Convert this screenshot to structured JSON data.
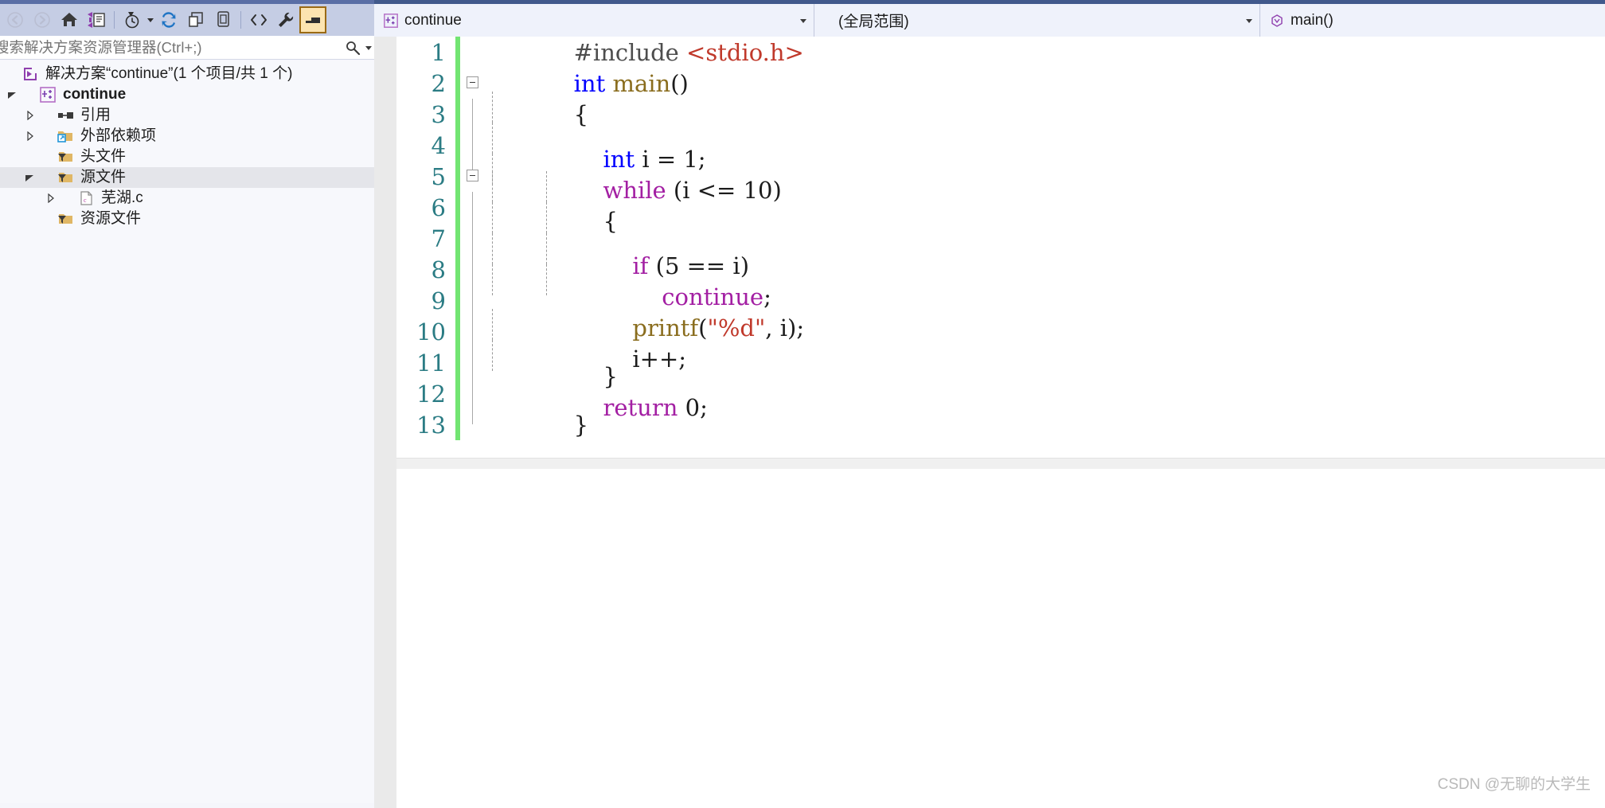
{
  "solution_explorer": {
    "toolbar": {
      "buttons": [
        {
          "name": "back-icon",
          "label": "后退"
        },
        {
          "name": "forward-icon",
          "label": "前进"
        },
        {
          "name": "home-icon",
          "label": "主页"
        },
        {
          "name": "sync-with-active-document-icon",
          "label": "与活动文档同步"
        },
        {
          "name": "pending-changes-filter-icon",
          "label": "挂起的更改筛选器"
        },
        {
          "name": "refresh-icon",
          "label": "刷新"
        },
        {
          "name": "collapse-all-icon",
          "label": "全部折叠"
        },
        {
          "name": "show-all-files-icon",
          "label": "显示所有文件"
        },
        {
          "name": "view-code-icon",
          "label": "查看代码"
        },
        {
          "name": "properties-icon",
          "label": "属性"
        },
        {
          "name": "preview-selected-items-icon",
          "label": "预览选定项"
        }
      ]
    },
    "search": {
      "placeholder": "搜索解决方案资源管理器(Ctrl+;)",
      "value": "",
      "icon": "search-icon",
      "dropdown_icon": "chevron-down-icon"
    },
    "tree": [
      {
        "label": "解决方案“continue”(1 个项目/共 1 个)",
        "icon": "solution-icon",
        "indent": 0,
        "twisty": "none",
        "bold": false,
        "selected": false
      },
      {
        "label": "continue",
        "icon": "cpp-project-icon",
        "indent": 1,
        "twisty": "expanded",
        "bold": true,
        "selected": false
      },
      {
        "label": "引用",
        "icon": "references-icon",
        "indent": 2,
        "twisty": "collapsed",
        "bold": false,
        "selected": false
      },
      {
        "label": "外部依赖项",
        "icon": "external-dependencies-icon",
        "indent": 2,
        "twisty": "collapsed",
        "bold": false,
        "selected": false
      },
      {
        "label": "头文件",
        "icon": "filter-folder-icon",
        "indent": 2,
        "twisty": "none",
        "bold": false,
        "selected": false
      },
      {
        "label": "源文件",
        "icon": "filter-folder-icon",
        "indent": 2,
        "twisty": "expanded",
        "bold": false,
        "selected": true
      },
      {
        "label": "芜湖.c",
        "icon": "c-file-icon",
        "indent": 3,
        "twisty": "collapsed",
        "bold": false,
        "selected": false
      },
      {
        "label": "资源文件",
        "icon": "filter-folder-icon",
        "indent": 2,
        "twisty": "none",
        "bold": false,
        "selected": false
      }
    ]
  },
  "navigation_bar": {
    "project_combo": {
      "value": "continue",
      "icon": "cpp-project-icon",
      "dropdown_icon": "chevron-down-icon"
    },
    "scope_combo": {
      "value": "(全局范围)",
      "dropdown_icon": "chevron-down-icon"
    },
    "member_combo": {
      "value": "main()",
      "icon": "method-icon",
      "dropdown_icon": "chevron-down-icon"
    }
  },
  "editor": {
    "lines": [
      {
        "number": "1",
        "fold": "none",
        "guides": 0,
        "tokens": [
          {
            "t": "#include ",
            "c": "pre"
          },
          {
            "t": "<stdio.h>",
            "c": "red"
          }
        ]
      },
      {
        "number": "2",
        "fold": "box",
        "guides": 0,
        "tokens": [
          {
            "t": "int",
            "c": "blue"
          },
          {
            "t": " ",
            "c": "plain"
          },
          {
            "t": "main",
            "c": "brown"
          },
          {
            "t": "()",
            "c": "plain"
          }
        ]
      },
      {
        "number": "3",
        "fold": "line",
        "guides": 0,
        "tokens": [
          {
            "t": "{",
            "c": "plain"
          }
        ]
      },
      {
        "number": "4",
        "fold": "line",
        "guides": 1,
        "tokens": [
          {
            "t": "    ",
            "c": "plain"
          },
          {
            "t": "int",
            "c": "blue"
          },
          {
            "t": " i = ",
            "c": "plain"
          },
          {
            "t": "1",
            "c": "plain"
          },
          {
            "t": ";",
            "c": "plain"
          }
        ]
      },
      {
        "number": "5",
        "fold": "box",
        "guides": 1,
        "tokens": [
          {
            "t": "    ",
            "c": "plain"
          },
          {
            "t": "while",
            "c": "purple"
          },
          {
            "t": " (i <= ",
            "c": "plain"
          },
          {
            "t": "10",
            "c": "plain"
          },
          {
            "t": ")",
            "c": "plain"
          }
        ]
      },
      {
        "number": "6",
        "fold": "line",
        "guides": 1,
        "tokens": [
          {
            "t": "    {",
            "c": "plain"
          }
        ]
      },
      {
        "number": "7",
        "fold": "line",
        "guides": 2,
        "tokens": [
          {
            "t": "        ",
            "c": "plain"
          },
          {
            "t": "if",
            "c": "purple"
          },
          {
            "t": " (",
            "c": "plain"
          },
          {
            "t": "5",
            "c": "plain"
          },
          {
            "t": " == i)",
            "c": "plain"
          }
        ]
      },
      {
        "number": "8",
        "fold": "line",
        "guides": 2,
        "tokens": [
          {
            "t": "            ",
            "c": "plain"
          },
          {
            "t": "continue",
            "c": "purple"
          },
          {
            "t": ";",
            "c": "plain"
          }
        ]
      },
      {
        "number": "9",
        "fold": "line",
        "guides": 2,
        "tokens": [
          {
            "t": "        ",
            "c": "plain"
          },
          {
            "t": "printf",
            "c": "brown"
          },
          {
            "t": "(",
            "c": "plain"
          },
          {
            "t": "\"%d\"",
            "c": "red"
          },
          {
            "t": ", i);",
            "c": "plain"
          }
        ]
      },
      {
        "number": "10",
        "fold": "line",
        "guides": 2,
        "tokens": [
          {
            "t": "        i++;",
            "c": "plain"
          }
        ]
      },
      {
        "number": "11",
        "fold": "line",
        "guides": 1,
        "tokens": [
          {
            "t": "    }",
            "c": "plain"
          }
        ]
      },
      {
        "number": "12",
        "fold": "line",
        "guides": 1,
        "tokens": [
          {
            "t": "    ",
            "c": "plain"
          },
          {
            "t": "return",
            "c": "purple"
          },
          {
            "t": " ",
            "c": "plain"
          },
          {
            "t": "0",
            "c": "plain"
          },
          {
            "t": ";",
            "c": "plain"
          }
        ]
      },
      {
        "number": "13",
        "fold": "line-end",
        "guides": 0,
        "tokens": [
          {
            "t": "}",
            "c": "plain"
          }
        ]
      }
    ]
  },
  "watermark": {
    "text": "CSDN @无聊的大学生"
  },
  "colors": {
    "changebar_green": "#72e572",
    "linenumber_teal": "#2b7c84",
    "keyword_blue": "#0000ff",
    "keyword_purple": "#a31fa3",
    "identifier_brown": "#8a6d1e",
    "string_red": "#c0392b",
    "selection_gray": "#e4e5ea",
    "toolbar_blue": "#c5cde4",
    "accent_border": "#5a6ea5"
  }
}
